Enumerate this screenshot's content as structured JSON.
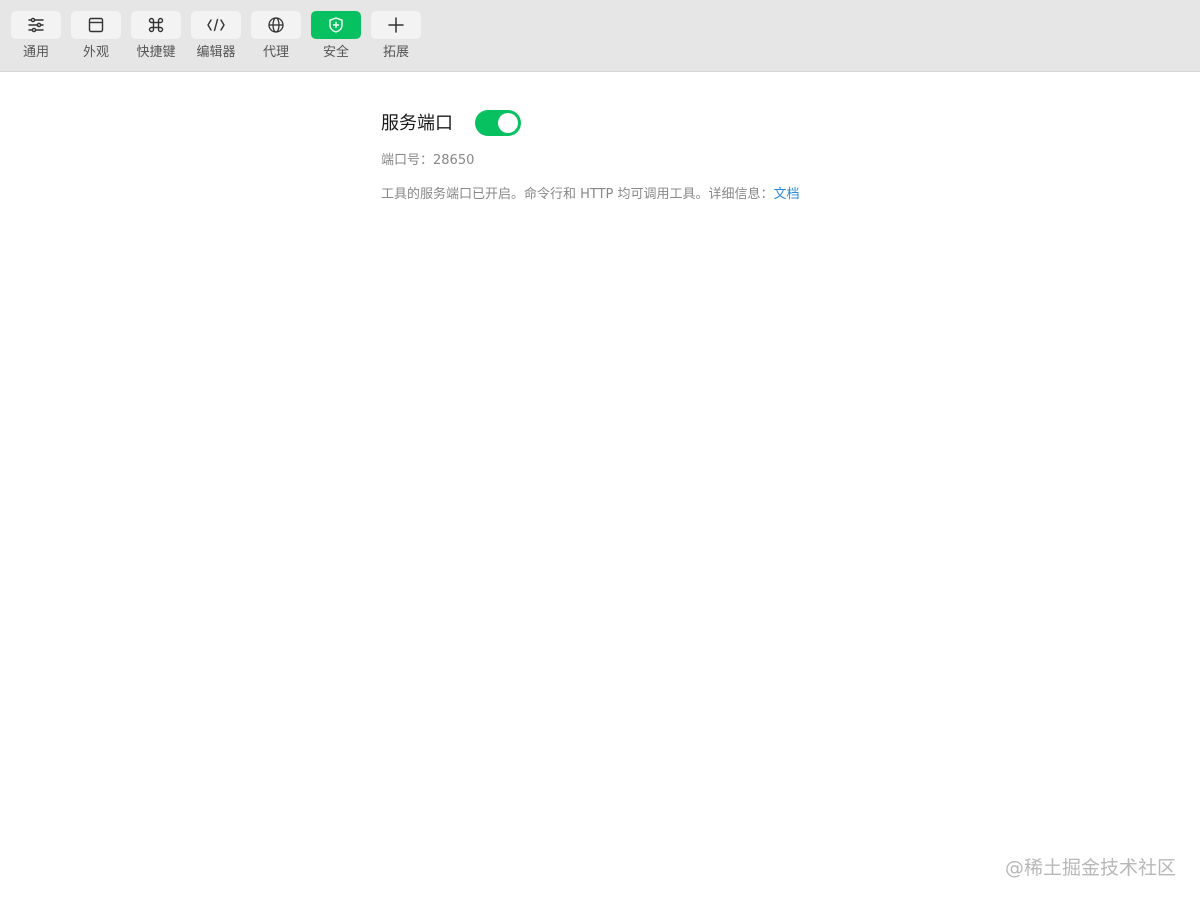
{
  "toolbar": {
    "tabs": [
      {
        "label": "通用",
        "icon": "sliders-icon"
      },
      {
        "label": "外观",
        "icon": "window-icon"
      },
      {
        "label": "快捷键",
        "icon": "command-key-icon"
      },
      {
        "label": "编辑器",
        "icon": "code-icon"
      },
      {
        "label": "代理",
        "icon": "globe-icon"
      },
      {
        "label": "安全",
        "icon": "shield-icon",
        "active": true
      },
      {
        "label": "拓展",
        "icon": "plus-icon"
      }
    ],
    "active_color": "#07c160"
  },
  "service_port": {
    "title": "服务端口",
    "enabled": true,
    "port_label": "端口号：",
    "port_value": "28650",
    "description": "工具的服务端口已开启。命令行和 HTTP 均可调用工具。详细信息：",
    "doc_link": "文档",
    "link_color": "#2c8cd6"
  },
  "watermark": "@稀土掘金技术社区"
}
